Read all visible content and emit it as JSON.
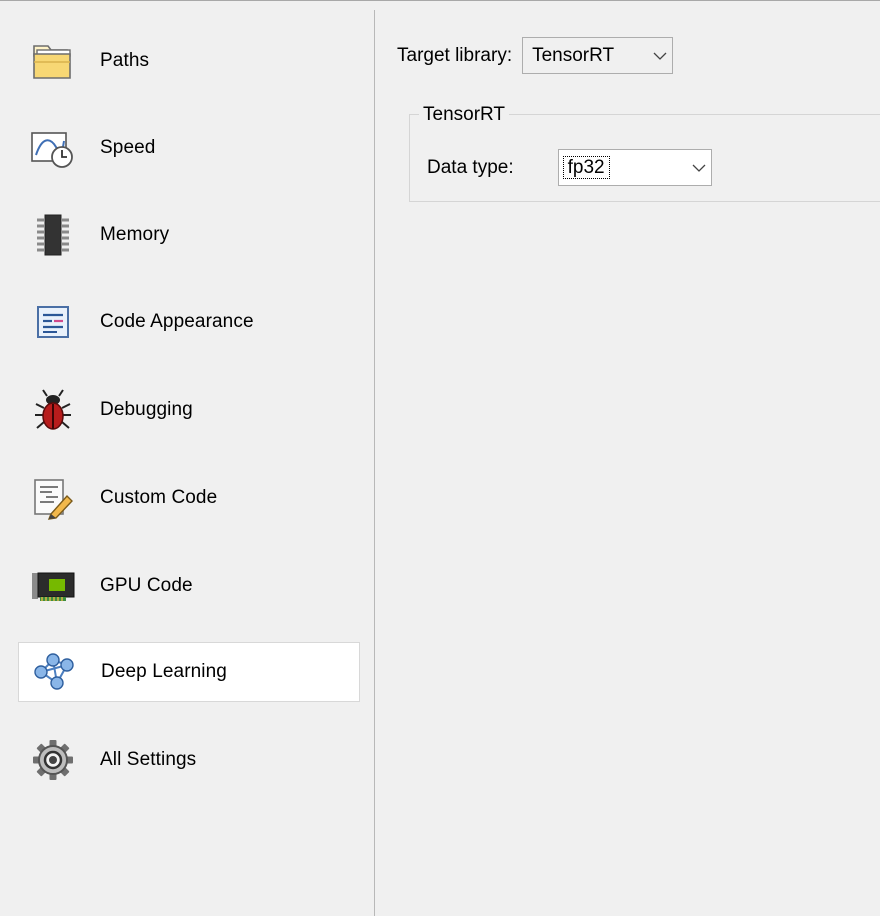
{
  "sidebar": {
    "items": [
      {
        "label": "Paths",
        "icon": "folder-icon"
      },
      {
        "label": "Speed",
        "icon": "speed-clock-icon"
      },
      {
        "label": "Memory",
        "icon": "memory-chip-icon"
      },
      {
        "label": "Code Appearance",
        "icon": "code-appearance-icon"
      },
      {
        "label": "Debugging",
        "icon": "bug-icon"
      },
      {
        "label": "Custom Code",
        "icon": "custom-code-icon"
      },
      {
        "label": "GPU Code",
        "icon": "gpu-card-icon"
      },
      {
        "label": "Deep Learning",
        "icon": "neural-network-icon",
        "selected": true
      },
      {
        "label": "All Settings",
        "icon": "gear-icon"
      }
    ]
  },
  "main": {
    "target_library": {
      "label": "Target library:",
      "value": "TensorRT"
    },
    "tensorrt_group": {
      "title": "TensorRT",
      "data_type": {
        "label": "Data type:",
        "value": "fp32"
      }
    }
  }
}
